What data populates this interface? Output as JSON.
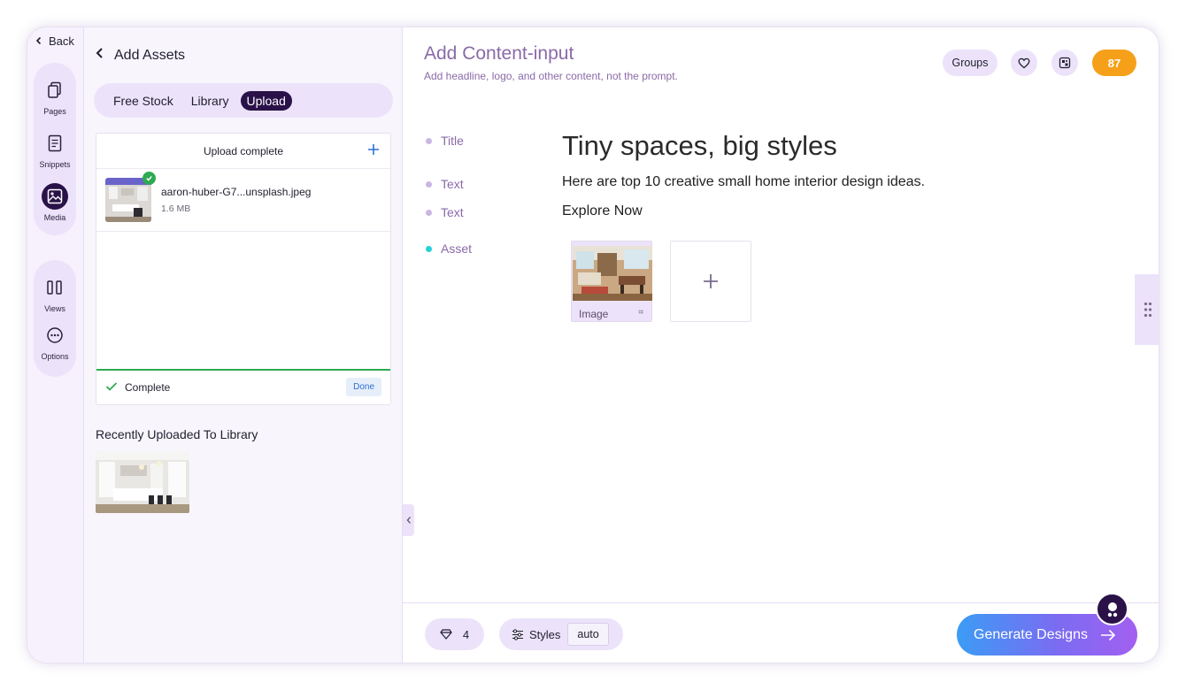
{
  "rail": {
    "back_label": "Back",
    "items": [
      {
        "label": "Pages",
        "icon": "pages-icon"
      },
      {
        "label": "Snippets",
        "icon": "snippets-icon"
      },
      {
        "label": "Media",
        "icon": "media-icon",
        "active": true
      },
      {
        "label": "Views",
        "icon": "views-icon"
      },
      {
        "label": "Options",
        "icon": "options-icon"
      }
    ]
  },
  "assets": {
    "title": "Add Assets",
    "tabs": [
      {
        "label": "Free Stock",
        "active": false
      },
      {
        "label": "Library",
        "active": false
      },
      {
        "label": "Upload",
        "active": true
      }
    ],
    "upload": {
      "header": "Upload complete",
      "file_name": "aaron-huber-G7...unsplash.jpeg",
      "file_size": "1.6 MB",
      "progress": 1.0,
      "status": "Complete",
      "done_label": "Done"
    },
    "recent_title": "Recently Uploaded To Library"
  },
  "main": {
    "title": "Add Content-input",
    "subtitle": "Add headline, logo, and other content, not the prompt.",
    "groups_label": "Groups",
    "credits": "87",
    "fields": [
      {
        "label": "Title",
        "value": "Tiny spaces, big styles"
      },
      {
        "label": "Text",
        "value": "Here are top 10 creative small home interior design ideas."
      },
      {
        "label": "Text",
        "value": "Explore Now"
      },
      {
        "label": "Asset"
      }
    ],
    "asset_caption": "Image"
  },
  "footer": {
    "gem_count": "4",
    "styles_label": "Styles",
    "styles_value": "auto",
    "generate_label": "Generate Designs"
  },
  "colors": {
    "accent_dark": "#2a1249",
    "lavender": "#ece3fa",
    "credits_orange": "#f6a019",
    "success_green": "#2eaa52"
  }
}
